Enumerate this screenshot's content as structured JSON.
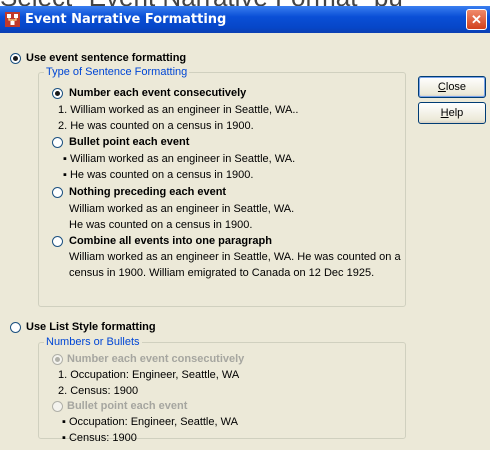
{
  "background_caption": "Select \"Event Narrative Format\" bu",
  "window": {
    "title": "Event Narrative Formatting",
    "close_glyph": "✕"
  },
  "sentence": {
    "label": "Use event sentence formatting",
    "group_title": "Type of Sentence Formatting",
    "options": [
      {
        "label": "Number each event consecutively",
        "lines": [
          "1. William worked as an engineer in Seattle, WA..",
          "2. He was counted on a census in 1900."
        ]
      },
      {
        "label": "Bullet point each event",
        "lines": [
          "▪ William worked as an engineer in Seattle, WA.",
          "▪ He was counted on a census in 1900."
        ]
      },
      {
        "label": "Nothing preceding each event",
        "lines": [
          "William worked as an engineer in Seattle, WA.",
          "He was counted on a census in 1900."
        ]
      },
      {
        "label": "Combine all events into one paragraph",
        "paragraph": "William worked as an engineer in Seattle, WA.  He was counted on a census in 1900.  William emigrated to Canada on 12 Dec 1925."
      }
    ]
  },
  "list": {
    "label": "Use List Style formatting",
    "group_title": "Numbers or Bullets",
    "options": [
      {
        "label": "Number each event consecutively",
        "lines": [
          "1. Occupation: Engineer, Seattle, WA",
          "2. Census: 1900"
        ]
      },
      {
        "label": "Bullet point each event",
        "lines": [
          "▪ Occupation: Engineer, Seattle, WA",
          "▪ Census: 1900"
        ]
      }
    ]
  },
  "buttons": {
    "close": {
      "mnemonic": "C",
      "rest": "lose"
    },
    "help": {
      "mnemonic": "H",
      "rest": "elp"
    }
  }
}
